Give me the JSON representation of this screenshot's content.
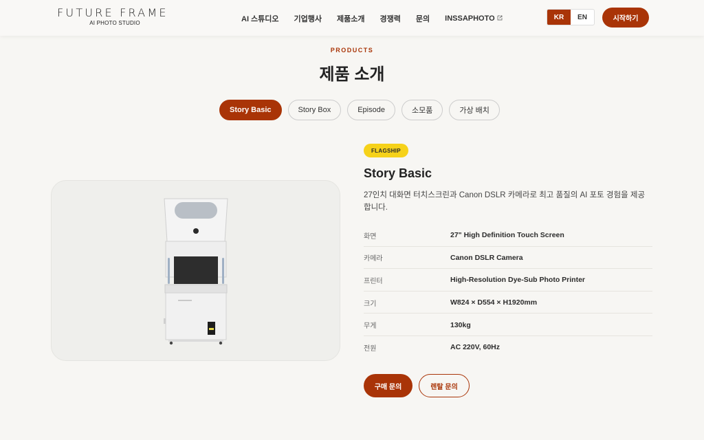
{
  "brand": {
    "name": "FUTURE FRAME",
    "tagline": "AI PHOTO STUDIO"
  },
  "nav": {
    "items": [
      {
        "label": "AI 스튜디오"
      },
      {
        "label": "기업행사"
      },
      {
        "label": "제품소개"
      },
      {
        "label": "경쟁력"
      },
      {
        "label": "문의"
      },
      {
        "label": "INSSAPHOTO",
        "icon": "external-link-icon"
      }
    ]
  },
  "language": {
    "options": [
      "KR",
      "EN"
    ],
    "selected": "KR"
  },
  "header": {
    "cta_label": "시작하기"
  },
  "section": {
    "eyebrow": "PRODUCTS",
    "title": "제품 소개"
  },
  "tabs": [
    {
      "label": "Story Basic",
      "active": true
    },
    {
      "label": "Story Box",
      "active": false
    },
    {
      "label": "Episode",
      "active": false
    },
    {
      "label": "소모품",
      "active": false
    },
    {
      "label": "가상 배치",
      "active": false
    }
  ],
  "product": {
    "badge": "FLAGSHIP",
    "name": "Story Basic",
    "description": "27인치 대화면 터치스크린과 Canon DSLR 카메라로 최고 품질의 AI 포토 경험을 제공합니다.",
    "specs": [
      {
        "label": "화면",
        "value": "27\" High Definition Touch Screen"
      },
      {
        "label": "카메라",
        "value": "Canon DSLR Camera"
      },
      {
        "label": "프린터",
        "value": "High-Resolution Dye-Sub Photo Printer"
      },
      {
        "label": "크기",
        "value": "W824 × D554 × H1920mm"
      },
      {
        "label": "무게",
        "value": "130kg"
      },
      {
        "label": "전원",
        "value": "AC 220V, 60Hz"
      }
    ],
    "actions": {
      "purchase_label": "구매 문의",
      "rental_label": "렌탈 문의"
    }
  },
  "colors": {
    "accent": "#a93407",
    "badge": "#f6d21a",
    "background": "#f7f6f3"
  }
}
